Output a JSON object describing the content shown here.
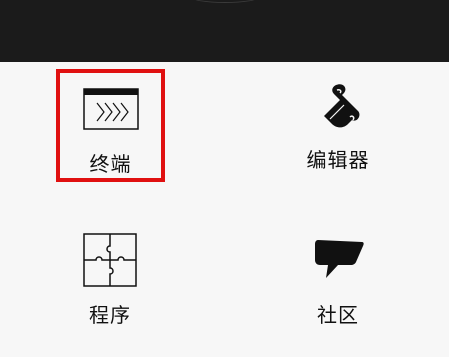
{
  "tiles": [
    {
      "label": "终端",
      "icon": "terminal-icon",
      "selected": true
    },
    {
      "label": "编辑器",
      "icon": "scroll-icon",
      "selected": false
    },
    {
      "label": "程序",
      "icon": "puzzle-icon",
      "selected": false
    },
    {
      "label": "社区",
      "icon": "speech-bubble-icon",
      "selected": false
    }
  ],
  "colors": {
    "top_bar": "#1b1b1b",
    "background": "#f7f7f7",
    "selection_border": "#e01010"
  }
}
